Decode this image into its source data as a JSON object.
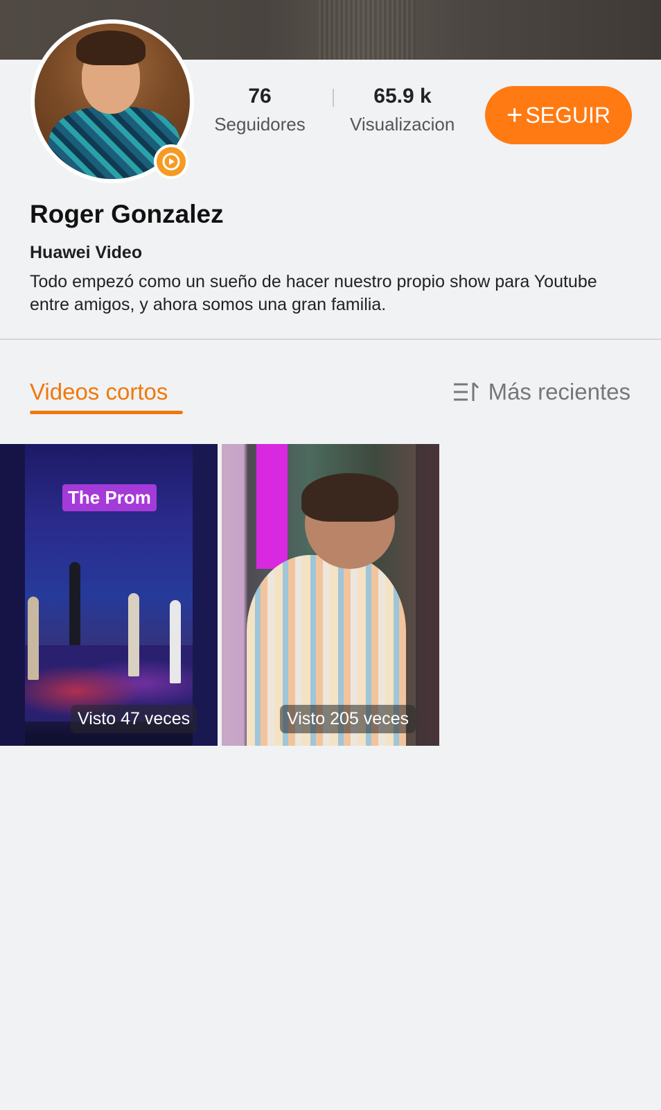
{
  "profile": {
    "name": "Roger Gonzalez",
    "source": "Huawei Video",
    "bio": "Todo empezó como un sueño de hacer nuestro propio show para Youtube entre amigos, y ahora somos una gran familia."
  },
  "stats": {
    "followers_value": "76",
    "followers_label": "Seguidores",
    "views_value": "65.9 k",
    "views_label": "Visualizaciones"
  },
  "follow_button": {
    "plus": "+",
    "label": "SEGUIR"
  },
  "tabs": {
    "active_label": "Videos cortos",
    "sort_label": "Más recientes"
  },
  "videos": [
    {
      "overlay_title": "The Prom",
      "views": "Visto 47 veces"
    },
    {
      "views": "Visto 205 veces"
    }
  ],
  "colors": {
    "accent": "#ff7a12",
    "tab_accent": "#f0780a",
    "background": "#f1f2f4"
  }
}
